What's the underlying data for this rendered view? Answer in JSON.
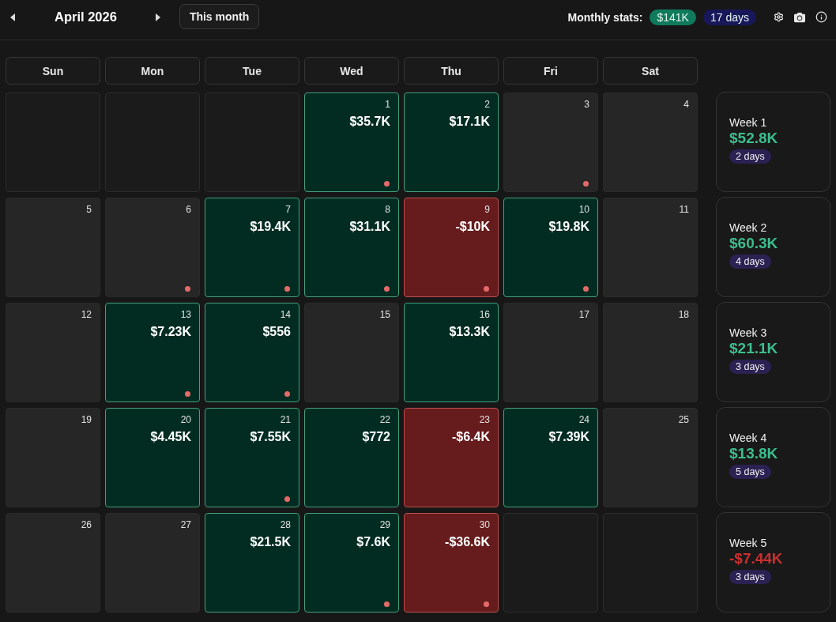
{
  "header": {
    "title": "April 2026",
    "today_button": "This month",
    "stats_label": "Monthly stats:",
    "stats_pnl": "$141K",
    "stats_days": "17 days"
  },
  "weekdays": [
    "Sun",
    "Mon",
    "Tue",
    "Wed",
    "Thu",
    "Fri",
    "Sat"
  ],
  "weeks": [
    {
      "label": "Week 1",
      "pnl": "$52.8K",
      "kind": "profit",
      "days": "2 days",
      "cells": [
        {
          "kind": "blank"
        },
        {
          "kind": "blank"
        },
        {
          "kind": "blank"
        },
        {
          "kind": "profit",
          "day": "1",
          "pnl": "$35.7K",
          "marked": true
        },
        {
          "kind": "profit",
          "day": "2",
          "pnl": "$17.1K",
          "marked": false
        },
        {
          "kind": "flat",
          "day": "3",
          "marked": true
        },
        {
          "kind": "flat",
          "day": "4",
          "marked": false
        }
      ]
    },
    {
      "label": "Week 2",
      "pnl": "$60.3K",
      "kind": "profit",
      "days": "4 days",
      "cells": [
        {
          "kind": "flat",
          "day": "5",
          "marked": false
        },
        {
          "kind": "flat",
          "day": "6",
          "marked": true
        },
        {
          "kind": "profit",
          "day": "7",
          "pnl": "$19.4K",
          "marked": true
        },
        {
          "kind": "profit",
          "day": "8",
          "pnl": "$31.1K",
          "marked": true
        },
        {
          "kind": "loss",
          "day": "9",
          "pnl": "-$10K",
          "marked": true
        },
        {
          "kind": "profit",
          "day": "10",
          "pnl": "$19.8K",
          "marked": true
        },
        {
          "kind": "flat",
          "day": "11",
          "marked": false
        }
      ]
    },
    {
      "label": "Week 3",
      "pnl": "$21.1K",
      "kind": "profit",
      "days": "3 days",
      "cells": [
        {
          "kind": "flat",
          "day": "12",
          "marked": false
        },
        {
          "kind": "profit",
          "day": "13",
          "pnl": "$7.23K",
          "marked": true
        },
        {
          "kind": "profit",
          "day": "14",
          "pnl": "$556",
          "marked": true
        },
        {
          "kind": "flat",
          "day": "15",
          "marked": false
        },
        {
          "kind": "profit",
          "day": "16",
          "pnl": "$13.3K",
          "marked": false
        },
        {
          "kind": "flat",
          "day": "17",
          "marked": false
        },
        {
          "kind": "flat",
          "day": "18",
          "marked": false
        }
      ]
    },
    {
      "label": "Week 4",
      "pnl": "$13.8K",
      "kind": "profit",
      "days": "5 days",
      "cells": [
        {
          "kind": "flat",
          "day": "19",
          "marked": false
        },
        {
          "kind": "profit",
          "day": "20",
          "pnl": "$4.45K",
          "marked": false
        },
        {
          "kind": "profit",
          "day": "21",
          "pnl": "$7.55K",
          "marked": true
        },
        {
          "kind": "profit",
          "day": "22",
          "pnl": "$772",
          "marked": false
        },
        {
          "kind": "loss",
          "day": "23",
          "pnl": "-$6.4K",
          "marked": false
        },
        {
          "kind": "profit",
          "day": "24",
          "pnl": "$7.39K",
          "marked": false
        },
        {
          "kind": "flat",
          "day": "25",
          "marked": false
        }
      ]
    },
    {
      "label": "Week 5",
      "pnl": "-$7.44K",
      "kind": "loss",
      "days": "3 days",
      "cells": [
        {
          "kind": "flat",
          "day": "26",
          "marked": false
        },
        {
          "kind": "flat",
          "day": "27",
          "marked": false
        },
        {
          "kind": "profit",
          "day": "28",
          "pnl": "$21.5K",
          "marked": false
        },
        {
          "kind": "profit",
          "day": "29",
          "pnl": "$7.6K",
          "marked": true
        },
        {
          "kind": "loss",
          "day": "30",
          "pnl": "-$36.6K",
          "marked": true
        },
        {
          "kind": "blank"
        },
        {
          "kind": "blank"
        }
      ]
    }
  ]
}
